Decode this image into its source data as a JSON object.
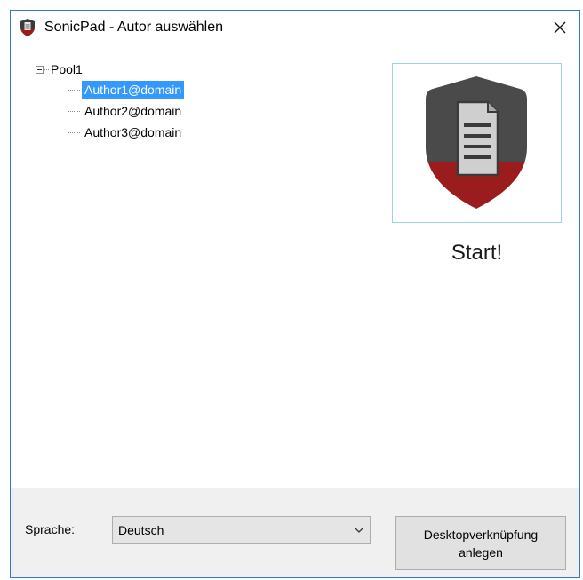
{
  "window": {
    "title": "SonicPad - Autor auswählen",
    "app_icon": "shield-document-icon",
    "close_icon": "close-icon",
    "border_color": "#2b79d8"
  },
  "tree": {
    "root": {
      "label": "Pool1",
      "expanded": true
    },
    "children": [
      {
        "label": "Author1@domain",
        "selected": true
      },
      {
        "label": "Author2@domain",
        "selected": false
      },
      {
        "label": "Author3@domain",
        "selected": false
      }
    ],
    "selection_color": "#3399ff"
  },
  "start": {
    "logo_icon": "shield-document-logo",
    "label": "Start!"
  },
  "footer": {
    "language_label": "Sprache:",
    "language_value": "Deutsch",
    "shortcut_button_line1": "Desktopverknüpfung",
    "shortcut_button_line2": "anlegen"
  },
  "colors": {
    "shield_dark": "#4a4a4a",
    "shield_red": "#9b1c1c"
  }
}
